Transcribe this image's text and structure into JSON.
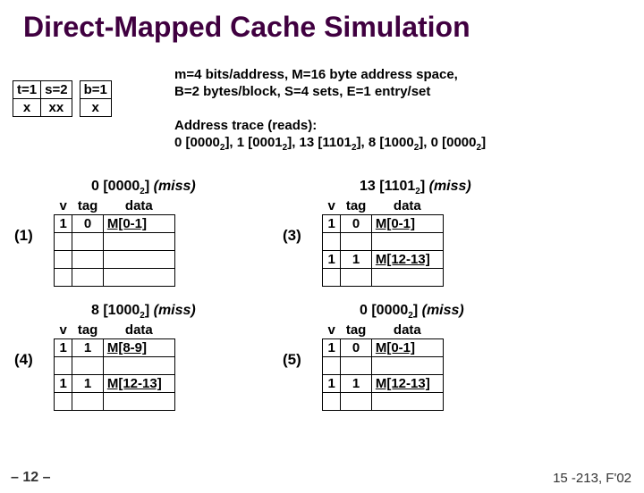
{
  "title": "Direct-Mapped Cache Simulation",
  "bits": {
    "h0": "t=1",
    "h1": "s=2",
    "h2": "b=1",
    "r0": "x",
    "r1": "xx",
    "r2": "x"
  },
  "params_l1": "m=4 bits/address, M=16 byte address space,",
  "params_l2": "B=2 bytes/block,  S=4 sets, E=1 entry/set",
  "trace_h": "Address trace (reads):",
  "trace_l": "0 [0000₂], 1 [0001₂],  13 [1101₂],  8 [1000₂],  0 [0000₂]",
  "steps": [
    {
      "n": "(1)",
      "cap_addr": "0 [0000",
      "cap_sub": "2",
      "cap_close": "]",
      "cap_res": "(miss)",
      "rows": [
        {
          "v": "1",
          "t": "0",
          "d": "M[0-1]"
        },
        {
          "v": "",
          "t": "",
          "d": ""
        },
        {
          "v": "",
          "t": "",
          "d": ""
        },
        {
          "v": "",
          "t": "",
          "d": ""
        }
      ]
    },
    {
      "n": "(3)",
      "cap_addr": "13 [1101",
      "cap_sub": "2",
      "cap_close": "]",
      "cap_res": "(miss)",
      "rows": [
        {
          "v": "1",
          "t": "0",
          "d": "M[0-1]"
        },
        {
          "v": "",
          "t": "",
          "d": ""
        },
        {
          "v": "1",
          "t": "1",
          "d": "M[12-13]"
        },
        {
          "v": "",
          "t": "",
          "d": ""
        }
      ]
    },
    {
      "n": "(4)",
      "cap_addr": "8 [1000",
      "cap_sub": "2",
      "cap_close": "]",
      "cap_res": "(miss)",
      "rows": [
        {
          "v": "1",
          "t": "1",
          "d": "M[8-9]"
        },
        {
          "v": "",
          "t": "",
          "d": ""
        },
        {
          "v": "1",
          "t": "1",
          "d": "M[12-13]"
        },
        {
          "v": "",
          "t": "",
          "d": ""
        }
      ]
    },
    {
      "n": "(5)",
      "cap_addr": "0 [0000",
      "cap_sub": "2",
      "cap_close": "]",
      "cap_res": "(miss)",
      "rows": [
        {
          "v": "1",
          "t": "0",
          "d": "M[0-1]"
        },
        {
          "v": "",
          "t": "",
          "d": ""
        },
        {
          "v": "1",
          "t": "1",
          "d": "M[12-13]"
        },
        {
          "v": "",
          "t": "",
          "d": ""
        }
      ]
    }
  ],
  "hdr": {
    "v": "v",
    "t": "tag",
    "d": "data"
  },
  "footer_l": "– 12 –",
  "footer_r": "15 -213, F'02"
}
